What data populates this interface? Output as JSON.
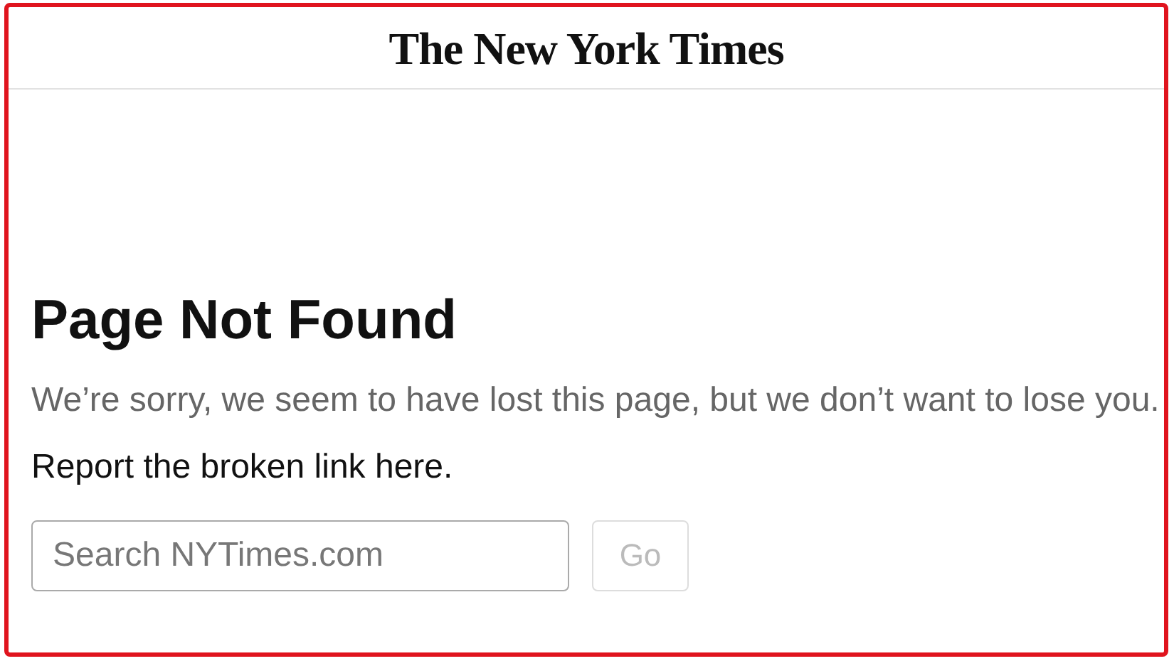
{
  "header": {
    "logo": "The New York Times"
  },
  "error": {
    "title": "Page Not Found",
    "message": "We’re sorry, we seem to have lost this page, but we don’t want to lose you.",
    "link": "Report the broken link here."
  },
  "search": {
    "placeholder": "Search NYTimes.com",
    "button": {
      "label": "Go",
      "disabled": true
    }
  }
}
